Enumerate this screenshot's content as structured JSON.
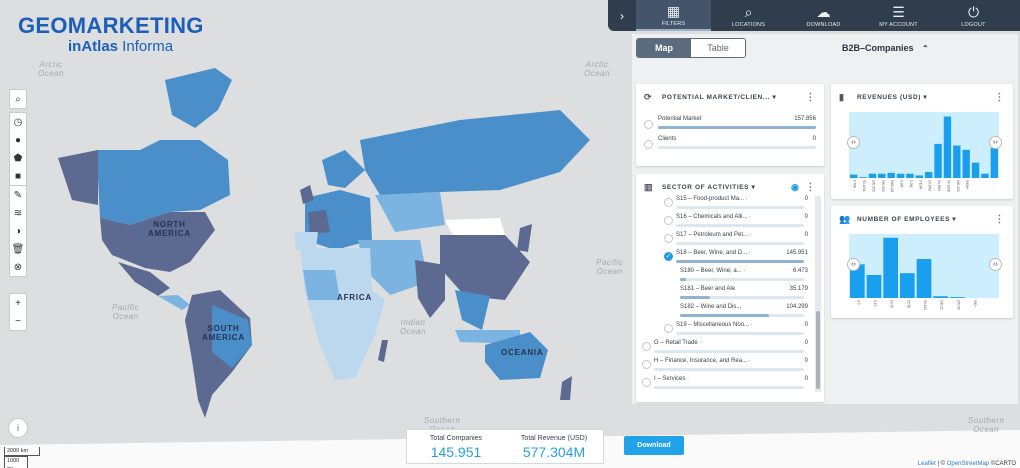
{
  "logo": {
    "brand": "GEOMARKETING",
    "sub_a": "inAtlas",
    "sub_b": " Informa"
  },
  "map": {
    "ocean_labels": [
      {
        "text": "Arctic\nOcean"
      },
      {
        "text": "Arctic\nOcean"
      },
      {
        "text": "Pacific\nOcean"
      },
      {
        "text": "Pacific\nOcean"
      },
      {
        "text": "Indian\nOcean"
      },
      {
        "text": "Southern\nOcean"
      },
      {
        "text": "Southern\nOcean"
      }
    ],
    "continent_labels": [
      "NORTH\nAMERICA",
      "SOUTH\nAMERICA",
      "AFRICA",
      "OCEANIA"
    ],
    "scale": {
      "big": "2000 km",
      "small": "1000 mi"
    },
    "attribution": {
      "leaflet": "Leaflet",
      "sep": " | © ",
      "osm": "OpenStreetMap",
      "carto": " ©CARTO"
    }
  },
  "toolbar": {
    "group1": [
      "search-icon"
    ],
    "group2": [
      "clock-icon",
      "circle-draw-icon",
      "pentagon-draw-icon",
      "square-draw-icon"
    ],
    "group3": [
      "edit-icon",
      "heatmap-icon",
      "contrast-icon",
      "trash-icon",
      "close-circle-icon"
    ],
    "zoom_in": "+",
    "zoom_out": "−"
  },
  "topnav": {
    "items": [
      {
        "label": "FILTERS",
        "icon": "▦",
        "active": true
      },
      {
        "label": "LOCATIONS",
        "icon": "⌕",
        "active": false
      },
      {
        "label": "DOWNLOAD",
        "icon": "☁",
        "active": false
      },
      {
        "label": "MY ACCOUNT",
        "icon": "☰",
        "active": false
      },
      {
        "label": "LOGOUT",
        "icon": "⏻",
        "active": false
      }
    ],
    "collapse": "›"
  },
  "panel": {
    "tab_map": "Map",
    "tab_table": "Table",
    "dataset_title": "B2B–Companies",
    "dataset_caret": "⌃",
    "market_card": {
      "title": "POTENTIAL MARKET/CLIEN... ▾",
      "rows": [
        {
          "label": "Potential Market",
          "value": "157.856",
          "fill": 1.0
        },
        {
          "label": "Clients",
          "value": "0",
          "fill": 0
        }
      ]
    },
    "sector_card": {
      "title": "SECTOR OF ACTIVITIES ▾",
      "rows": [
        {
          "label": "S15 – Food-product Ma...  ·",
          "value": "0",
          "indent": 1,
          "checked": false,
          "fill": 0
        },
        {
          "label": "S16 – Chemicals and Alli...  ·",
          "value": "0",
          "indent": 1,
          "checked": false,
          "fill": 0
        },
        {
          "label": "S17 – Petroleum and Pet...  ·",
          "value": "0",
          "indent": 1,
          "checked": false,
          "fill": 0
        },
        {
          "label": "S18 – Beer, Wine, and D...  ·",
          "value": "145.951",
          "indent": 1,
          "checked": true,
          "fill": 1.0
        },
        {
          "label": "S180 – Beer, Wine, a...  ·",
          "value": "6.473",
          "indent": 2,
          "checked": false,
          "fill": 0.05
        },
        {
          "label": "S181 – Beer and Ale",
          "value": "35.179",
          "indent": 2,
          "checked": false,
          "fill": 0.24
        },
        {
          "label": "S182 – Wine and Dis...",
          "value": "104.299",
          "indent": 2,
          "checked": false,
          "fill": 0.72
        },
        {
          "label": "S19 – Miscellaneous Non...  ·",
          "value": "0",
          "indent": 1,
          "checked": false,
          "fill": 0
        },
        {
          "label": "G – Retail Trade  ·",
          "value": "0",
          "indent": 0,
          "checked": false,
          "fill": 0
        },
        {
          "label": "H – Finance, Insurance, and Rea...  ·",
          "value": "0",
          "indent": 0,
          "checked": false,
          "fill": 0
        },
        {
          "label": "I – Services  ·",
          "value": "0",
          "indent": 0,
          "checked": false,
          "fill": 0
        }
      ]
    }
  },
  "revenues_card": {
    "title": "REVENUES (USD) ▾"
  },
  "employees_card": {
    "title": "NUMBER OF EMPLOYEES ▾"
  },
  "chart_data": [
    {
      "type": "bar",
      "title": "REVENUES (USD)",
      "categories": [
        "0-50k",
        "50-100k",
        "100-250k",
        "250-500k",
        "500k-1M",
        "1-2M",
        "2-5M",
        "5-10M",
        "10-20M",
        "20-50M",
        "50-100M",
        "100-500M",
        "500M+",
        "",
        "",
        ""
      ],
      "values": [
        4,
        1,
        5,
        5,
        6,
        5,
        5,
        3,
        7,
        40,
        72,
        38,
        33,
        18,
        5,
        35
      ],
      "ylim": [
        0,
        75
      ]
    },
    {
      "type": "bar",
      "title": "NUMBER OF EMPLOYEES",
      "categories": [
        "0-5",
        "5-10",
        "10-25",
        "25-50",
        "50-100",
        "100-250",
        "250-500",
        "500+",
        ""
      ],
      "values": [
        38,
        26,
        68,
        28,
        44,
        2,
        1,
        0,
        0
      ],
      "ylim": [
        0,
        70
      ]
    }
  ],
  "summary": {
    "companies_label": "Total Companies",
    "companies_value": "145.951",
    "revenue_label": "Total Revenue (USD)",
    "revenue_value": "577.304M"
  },
  "download_label": "Download",
  "colors": {
    "dark": "#5c6a91",
    "mid": "#4a8fc9",
    "light": "#7bb4e1",
    "pale": "#bcd8ee",
    "bar": "#1a9fef",
    "chartbg": "#cdeefc"
  }
}
